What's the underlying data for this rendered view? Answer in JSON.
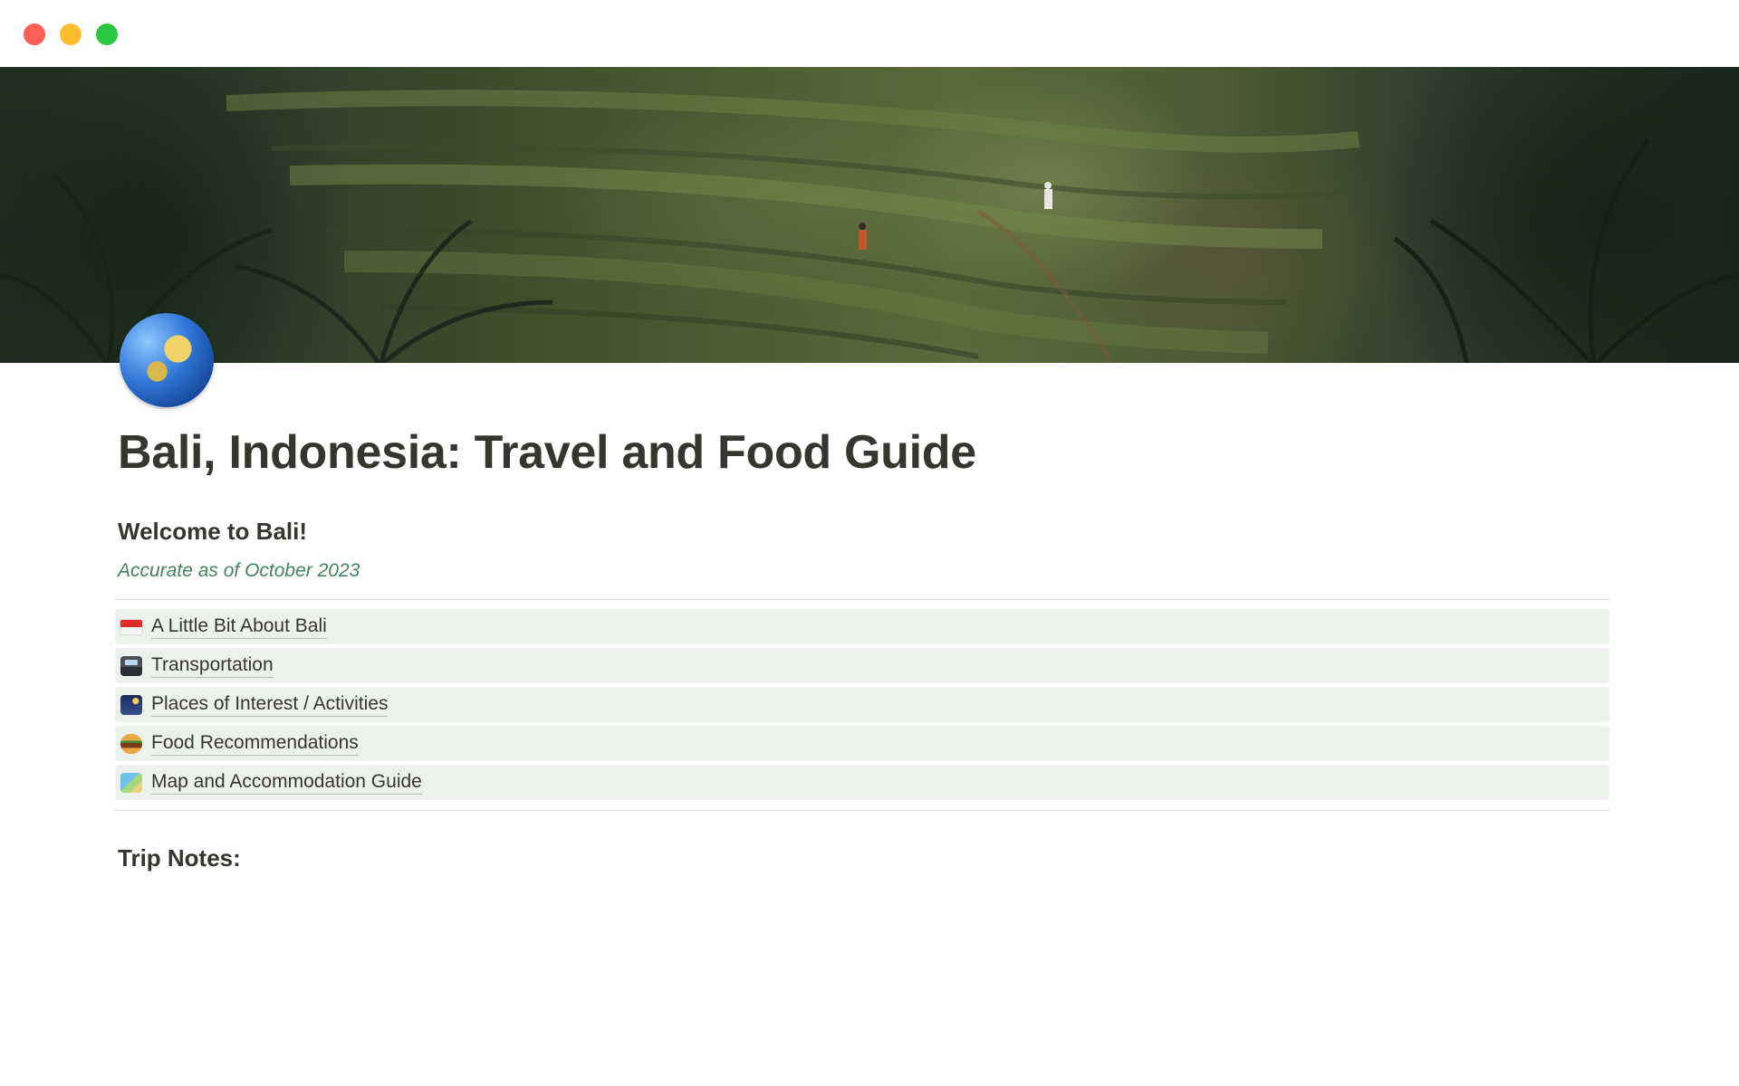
{
  "window": {
    "controls": [
      "close",
      "minimize",
      "zoom"
    ]
  },
  "cover": {
    "description_icon": "rice-terrace-cover-image"
  },
  "page": {
    "icon": "globe-showing-asia-australia-icon",
    "title": "Bali, Indonesia: Travel and Food Guide",
    "welcome_heading": "Welcome to Bali!",
    "accuracy_note": "Accurate as of October 2023",
    "trip_notes_heading": "Trip Notes:"
  },
  "links": [
    {
      "icon": "indonesia-flag-icon",
      "label": "A Little Bit About Bali"
    },
    {
      "icon": "train-icon",
      "label": "Transportation"
    },
    {
      "icon": "night-city-icon",
      "label": "Places of Interest / Activities"
    },
    {
      "icon": "burger-icon",
      "label": "Food Recommendations"
    },
    {
      "icon": "world-map-icon",
      "label": "Map and Accommodation Guide"
    }
  ],
  "colors": {
    "text": "#37352f",
    "accent_green_text": "#448361",
    "link_row_background": "#edf1eb",
    "close": "#fe5f57",
    "minimize": "#febc2e",
    "zoom": "#28c840"
  }
}
